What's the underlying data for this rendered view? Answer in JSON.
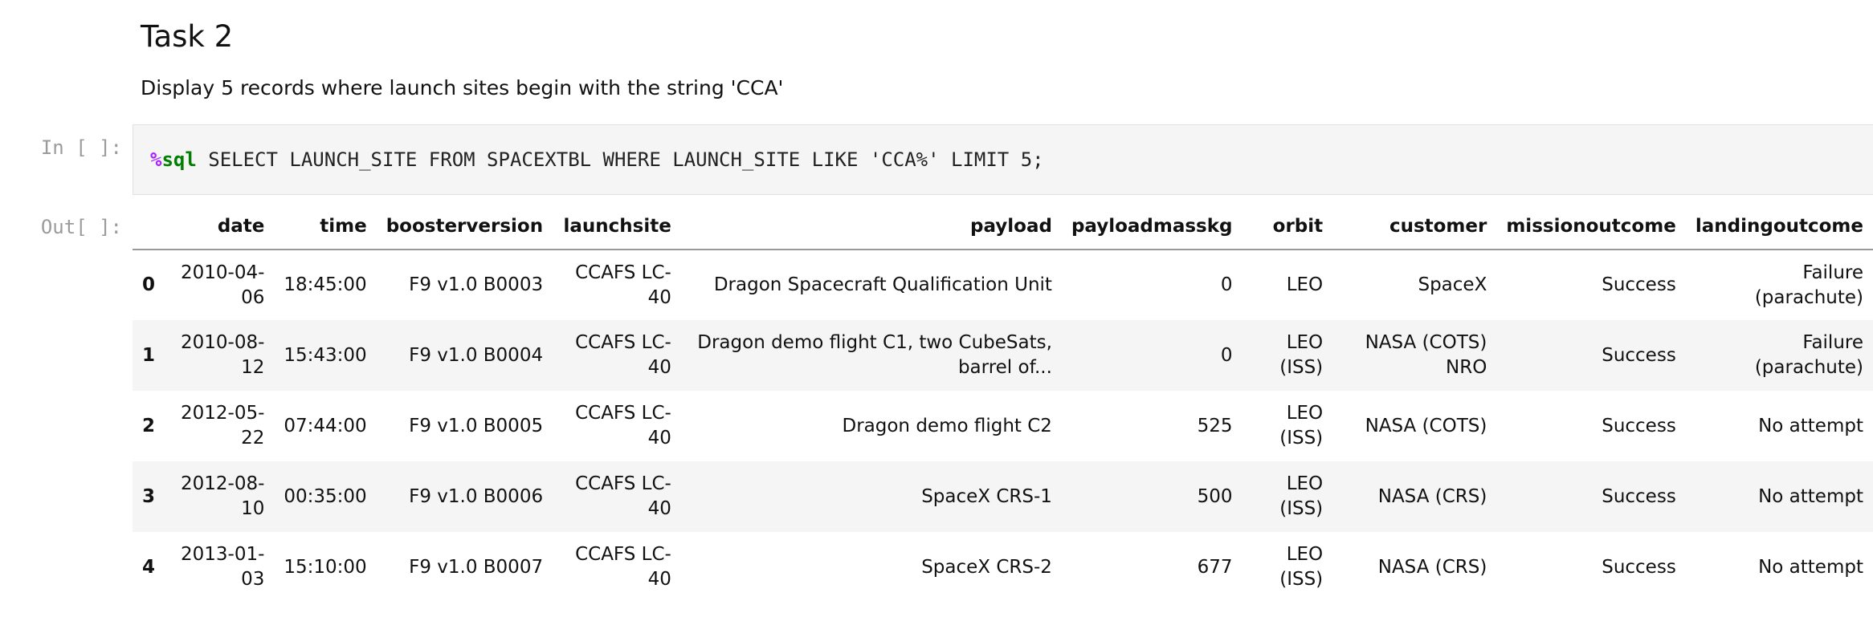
{
  "markdown": {
    "heading": "Task 2",
    "description": "Display 5 records where launch sites begin with the string 'CCA'"
  },
  "code_cell": {
    "prompt": "In [ ]:",
    "magic_percent": "%",
    "magic_name": "sql",
    "code": " SELECT LAUNCH_SITE FROM SPACEXTBL WHERE LAUNCH_SITE LIKE 'CCA%' LIMIT 5;"
  },
  "output": {
    "prompt": "Out[ ]:",
    "columns": [
      "",
      "date",
      "time",
      "boosterversion",
      "launchsite",
      "payload",
      "payloadmasskg",
      "orbit",
      "customer",
      "missionoutcome",
      "landingoutcome"
    ],
    "rows": [
      [
        "0",
        "2010-04-06",
        "18:45:00",
        "F9 v1.0 B0003",
        "CCAFS LC-40",
        "Dragon Spacecraft Qualification Unit",
        "0",
        "LEO",
        "SpaceX",
        "Success",
        "Failure (parachute)"
      ],
      [
        "1",
        "2010-08-12",
        "15:43:00",
        "F9 v1.0 B0004",
        "CCAFS LC-40",
        "Dragon demo flight C1, two CubeSats, barrel of...",
        "0",
        "LEO (ISS)",
        "NASA (COTS) NRO",
        "Success",
        "Failure (parachute)"
      ],
      [
        "2",
        "2012-05-22",
        "07:44:00",
        "F9 v1.0 B0005",
        "CCAFS LC-40",
        "Dragon demo flight C2",
        "525",
        "LEO (ISS)",
        "NASA (COTS)",
        "Success",
        "No attempt"
      ],
      [
        "3",
        "2012-08-10",
        "00:35:00",
        "F9 v1.0 B0006",
        "CCAFS LC-40",
        "SpaceX CRS-1",
        "500",
        "LEO (ISS)",
        "NASA (CRS)",
        "Success",
        "No attempt"
      ],
      [
        "4",
        "2013-01-03",
        "15:10:00",
        "F9 v1.0 B0007",
        "CCAFS LC-40",
        "SpaceX CRS-2",
        "677",
        "LEO (ISS)",
        "NASA (CRS)",
        "Success",
        "No attempt"
      ]
    ]
  }
}
